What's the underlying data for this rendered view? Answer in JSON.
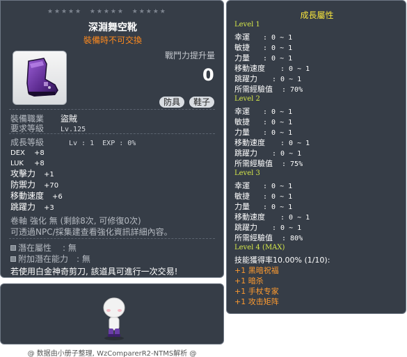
{
  "item": {
    "id": "01072547",
    "name": "深淵舞空靴",
    "trade_note": "裝備時不可交換",
    "combat_label": "戰鬥力提升量",
    "combat_value": "0",
    "tags": [
      "防具",
      "鞋子"
    ],
    "icon": "purple-boots-icon"
  },
  "requirements": {
    "job_label": "裝備職業",
    "job_value": "盜賊",
    "level_label": "要求等級",
    "level_value": "Lv.125"
  },
  "growth_row": {
    "label": "成長等級",
    "value": "Lv : 1  EXP : 0%"
  },
  "stats": [
    {
      "label": "DEX",
      "value": "+8"
    },
    {
      "label": "LUK",
      "value": "+8"
    },
    {
      "label": "攻擊力",
      "value": "+1"
    },
    {
      "label": "防禦力",
      "value": "+70"
    },
    {
      "label": "移動速度",
      "value": "+6"
    },
    {
      "label": "跳躍力",
      "value": "+3"
    }
  ],
  "enhance": {
    "line1": "卷軸 強化 無 (剩餘8次, 可修復0次)",
    "line2": "可透過NPC/採集建查看強化資訊詳細內容。"
  },
  "potential": {
    "label1": "潛在屬性",
    "value1": ": 無",
    "label2": "附加潛在能力",
    "value2": ": 無"
  },
  "notice": "若使用白金神奇剪刀, 該道具可進行一次交易!",
  "footer": "@ 数据由小册子整理, WzComparerR2-NTMS解析 @",
  "growth_panel": {
    "title": "成長屬性",
    "levels": [
      {
        "title": "Level 1",
        "stats": [
          {
            "k": "幸運",
            "v": ": 0 ~ 1"
          },
          {
            "k": "敏捷",
            "v": ": 0 ~ 1"
          },
          {
            "k": "力量",
            "v": ": 0 ~ 1"
          },
          {
            "k": "移動速度",
            "v": ": 0 ~ 1"
          },
          {
            "k": "跳躍力",
            "v": ": 0 ~ 1"
          },
          {
            "k": "所需經驗值",
            "v": ": 70%"
          }
        ]
      },
      {
        "title": "Level 2",
        "stats": [
          {
            "k": "幸運",
            "v": ": 0 ~ 1"
          },
          {
            "k": "敏捷",
            "v": ": 0 ~ 1"
          },
          {
            "k": "力量",
            "v": ": 0 ~ 1"
          },
          {
            "k": "移動速度",
            "v": ": 0 ~ 1"
          },
          {
            "k": "跳躍力",
            "v": ": 0 ~ 1"
          },
          {
            "k": "所需經驗值",
            "v": ": 75%"
          }
        ]
      },
      {
        "title": "Level 3",
        "stats": [
          {
            "k": "幸運",
            "v": ": 0 ~ 1"
          },
          {
            "k": "敏捷",
            "v": ": 0 ~ 1"
          },
          {
            "k": "力量",
            "v": ": 0 ~ 1"
          },
          {
            "k": "移動速度",
            "v": ": 0 ~ 1"
          },
          {
            "k": "跳躍力",
            "v": ": 0 ~ 1"
          },
          {
            "k": "所需經驗值",
            "v": ": 80%"
          }
        ]
      }
    ],
    "level4_title": "Level 4 (MAX)",
    "level4_rate": "技能獲得率10.00% (1/10):",
    "skills": [
      "+1 黑暗祝福",
      "+1 暗杀",
      "+1 手杖专家",
      "+1 攻击矩阵"
    ]
  },
  "colors": {
    "panel_bg": "#363d47",
    "accent_orange": "#ff8a1e",
    "level_yellow": "#d6e84a",
    "title_yellow": "#f5e33c"
  }
}
